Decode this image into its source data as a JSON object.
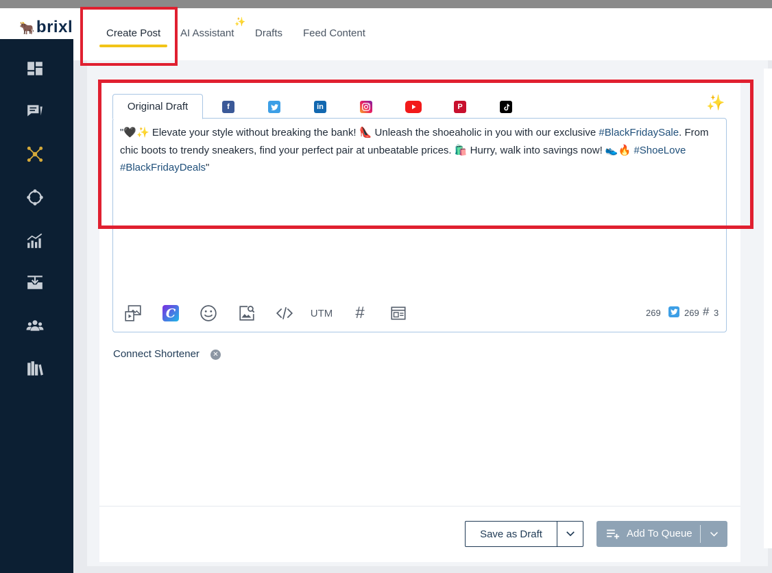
{
  "brand": {
    "name": "brixl"
  },
  "header": {
    "tabs": [
      {
        "label": "Create Post",
        "active": true
      },
      {
        "label": "AI Assistant",
        "active": false
      },
      {
        "label": "Drafts",
        "active": false
      },
      {
        "label": "Feed Content",
        "active": false
      }
    ]
  },
  "sidebar": {
    "icons": [
      "dashboard-icon",
      "compose-icon",
      "network-icon",
      "target-icon",
      "analytics-icon",
      "download-icon",
      "team-icon",
      "library-icon"
    ]
  },
  "editor": {
    "draft_tab_label": "Original Draft",
    "networks": [
      "facebook",
      "twitter",
      "linkedin",
      "instagram",
      "youtube",
      "pinterest",
      "tiktok"
    ],
    "post_parts": {
      "p1": "\"🖤✨ Elevate your style without breaking the bank! 👠 Unleash the shoeaholic in you with our exclusive ",
      "tag1": "#BlackFridaySale",
      "p2": ". From chic boots to trendy sneakers, find your perfect pair at unbeatable prices. 🛍️ Hurry, walk into savings now! 👟🔥 ",
      "tag2": "#ShoeLove",
      "p3": " ",
      "tag3": "#BlackFridayDeals",
      "p4": "\""
    },
    "toolbar": {
      "utm_label": "UTM",
      "hash_label": "#"
    },
    "counts": {
      "chars": "269",
      "twitter_chars": "269",
      "hashtags_icon": "#",
      "hashtags": "3"
    }
  },
  "shortener": {
    "label": "Connect Shortener"
  },
  "footer": {
    "save_draft_label": "Save as Draft",
    "add_queue_label": "Add To Queue"
  },
  "colors": {
    "accent_yellow": "#f2c418",
    "highlight_red": "#e02030",
    "sidebar": "#0c1f33",
    "queue_button": "#8fa3b5"
  }
}
